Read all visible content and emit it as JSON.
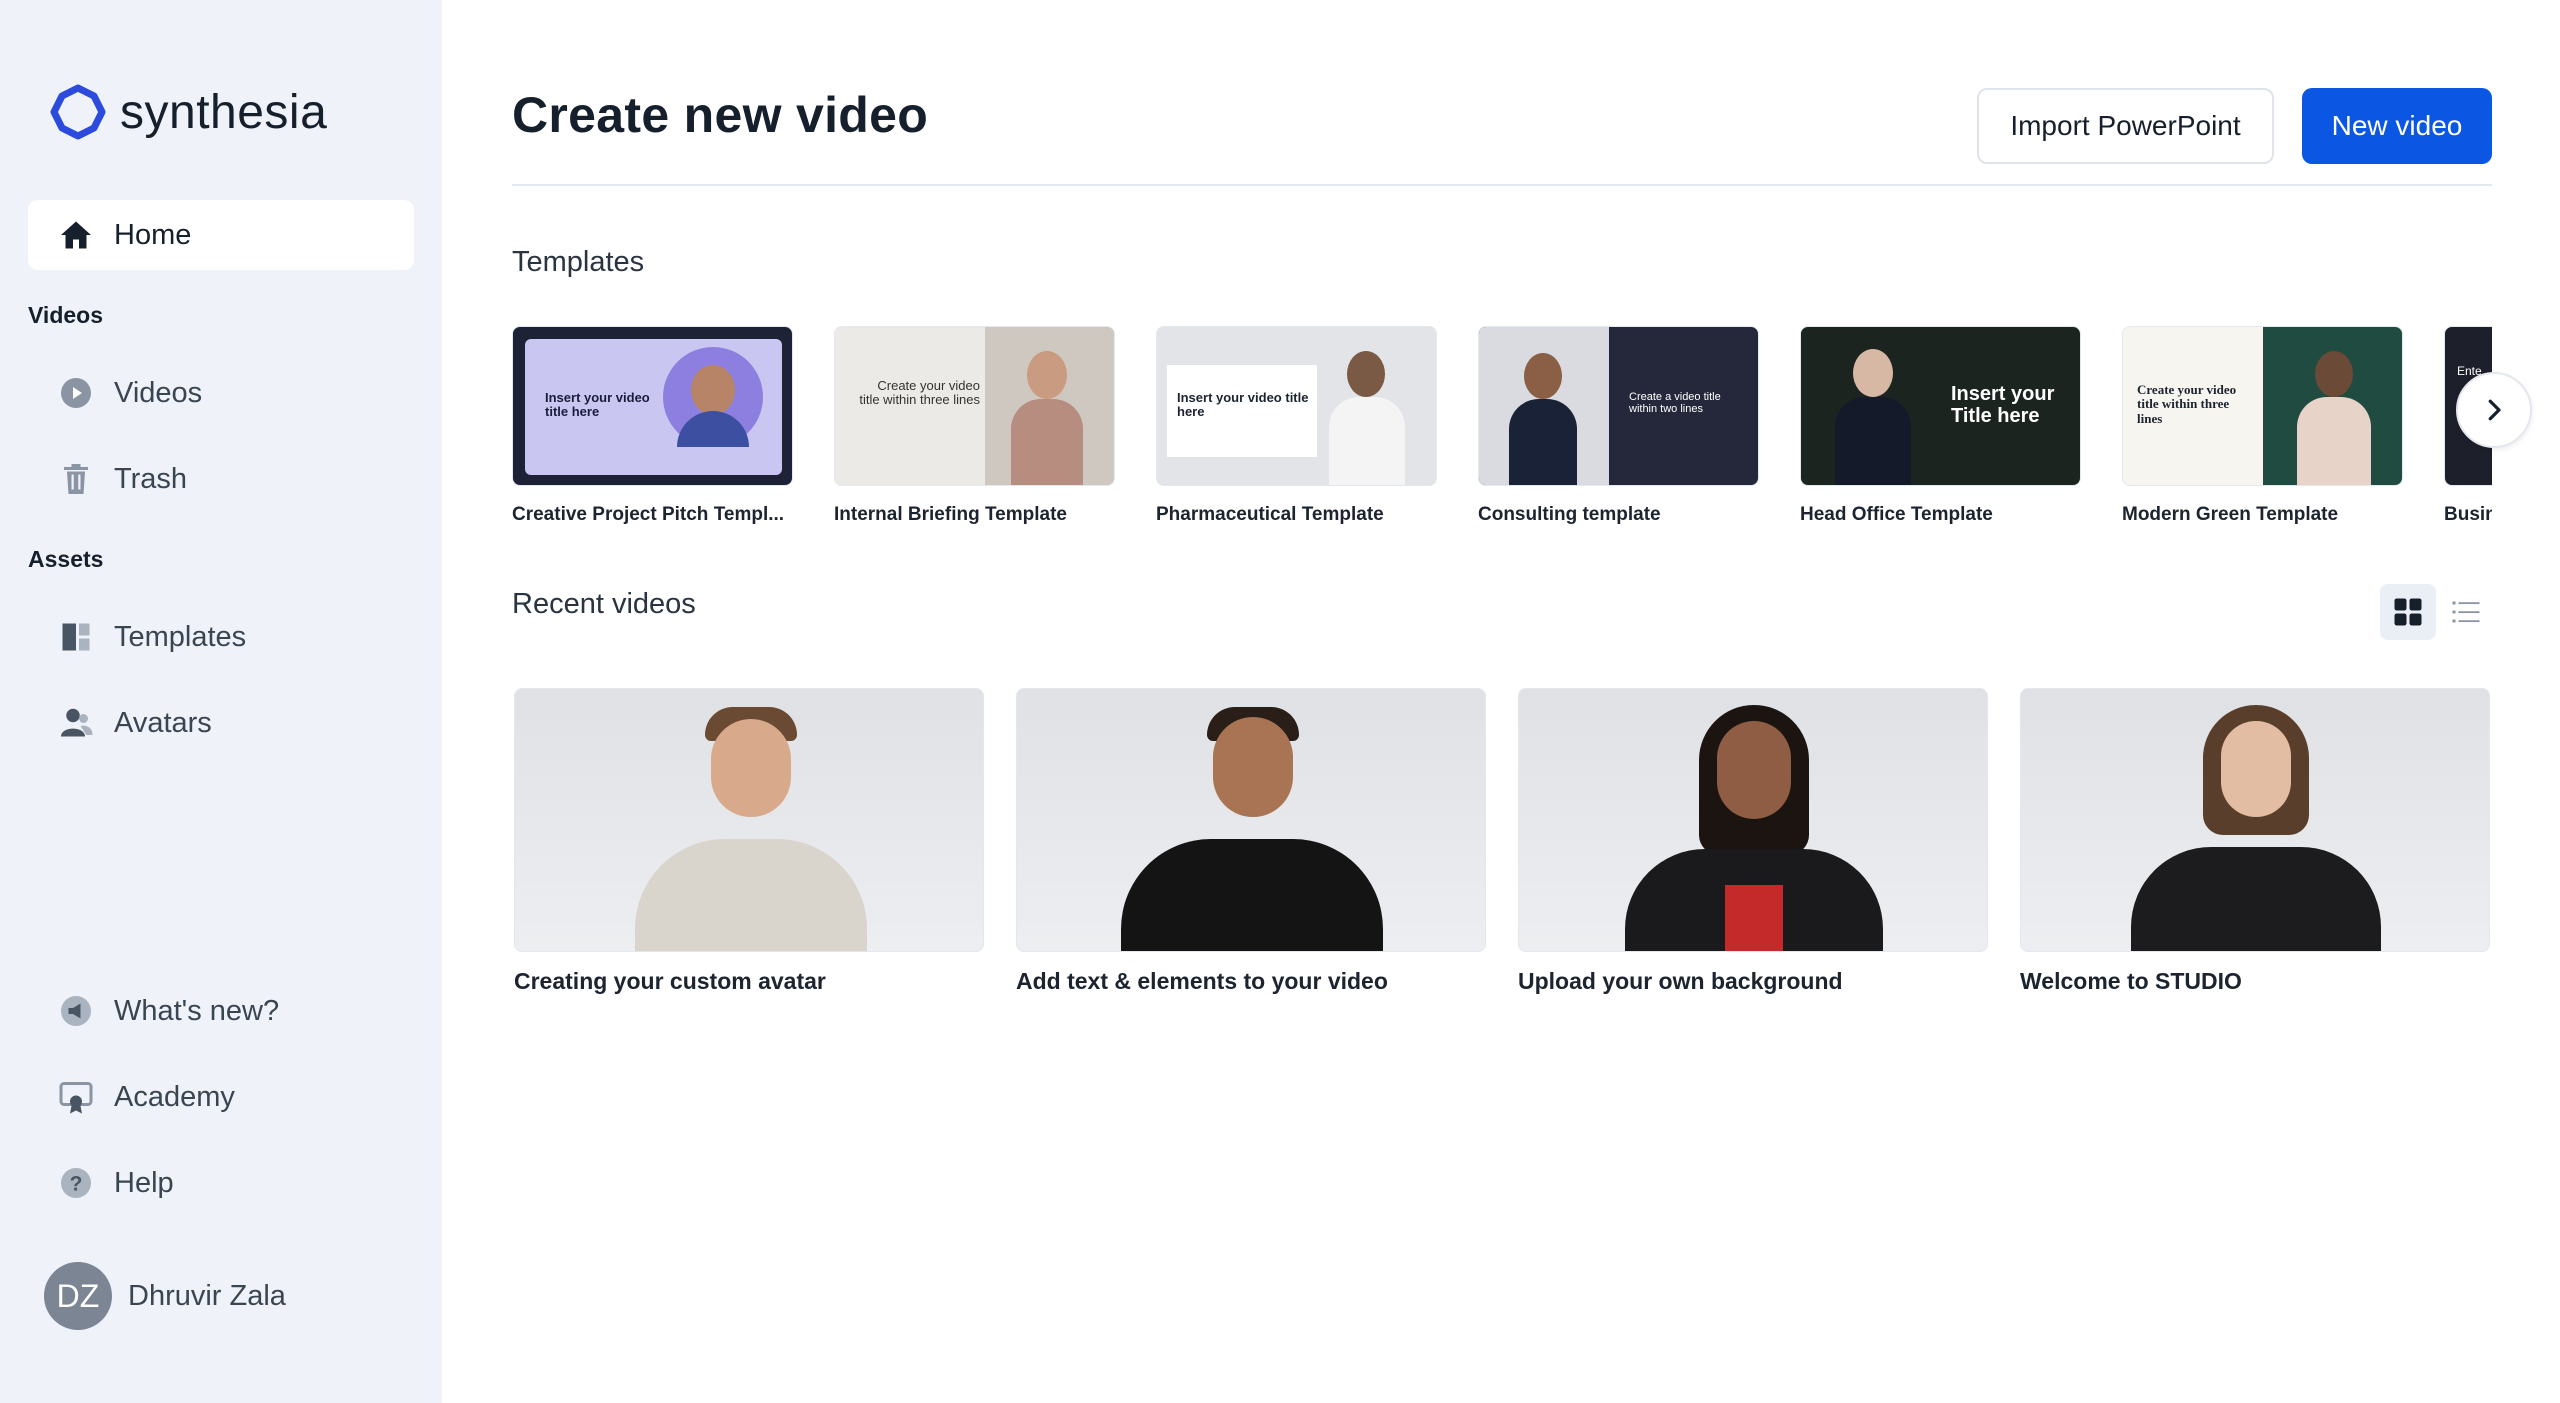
{
  "brand": {
    "name": "synthesia"
  },
  "sidebar": {
    "home": "Home",
    "videos_section": "Videos",
    "videos": "Videos",
    "trash": "Trash",
    "assets_section": "Assets",
    "templates": "Templates",
    "avatars": "Avatars",
    "whats_new": "What's new?",
    "academy": "Academy",
    "help": "Help",
    "user": {
      "initials": "DZ",
      "name": "Dhruvir Zala"
    }
  },
  "header": {
    "title": "Create new video",
    "import_label": "Import PowerPoint",
    "new_video_label": "New video"
  },
  "templates": {
    "title": "Templates",
    "items": [
      {
        "label": "Creative Project Pitch Templ...",
        "thumb_text": "Insert your video title here",
        "icon": "avatar-man"
      },
      {
        "label": "Internal Briefing Template",
        "thumb_text": "Create your video title within three lines",
        "icon": "avatar-woman"
      },
      {
        "label": "Pharmaceutical Template",
        "thumb_text": "Insert your video title here",
        "icon": "avatar-doctor"
      },
      {
        "label": "Consulting template",
        "thumb_text": "Create a video title within two lines",
        "icon": "avatar-woman"
      },
      {
        "label": "Head Office Template",
        "thumb_text": "Insert your Title here",
        "icon": "avatar-woman"
      },
      {
        "label": "Modern Green Template",
        "thumb_text": "Create your video title within three lines",
        "icon": "avatar-man"
      },
      {
        "label": "Busine",
        "thumb_text": "Ente",
        "icon": "avatar"
      }
    ]
  },
  "recent": {
    "title": "Recent videos",
    "items": [
      {
        "label": "Creating your custom avatar"
      },
      {
        "label": "Add text & elements to your video"
      },
      {
        "label": "Upload your own background"
      },
      {
        "label": "Welcome to STUDIO"
      }
    ]
  },
  "colors": {
    "accent": "#0b57e3",
    "sidebar_bg": "#eff2f9",
    "brand_icon": "#2c4bdc"
  }
}
